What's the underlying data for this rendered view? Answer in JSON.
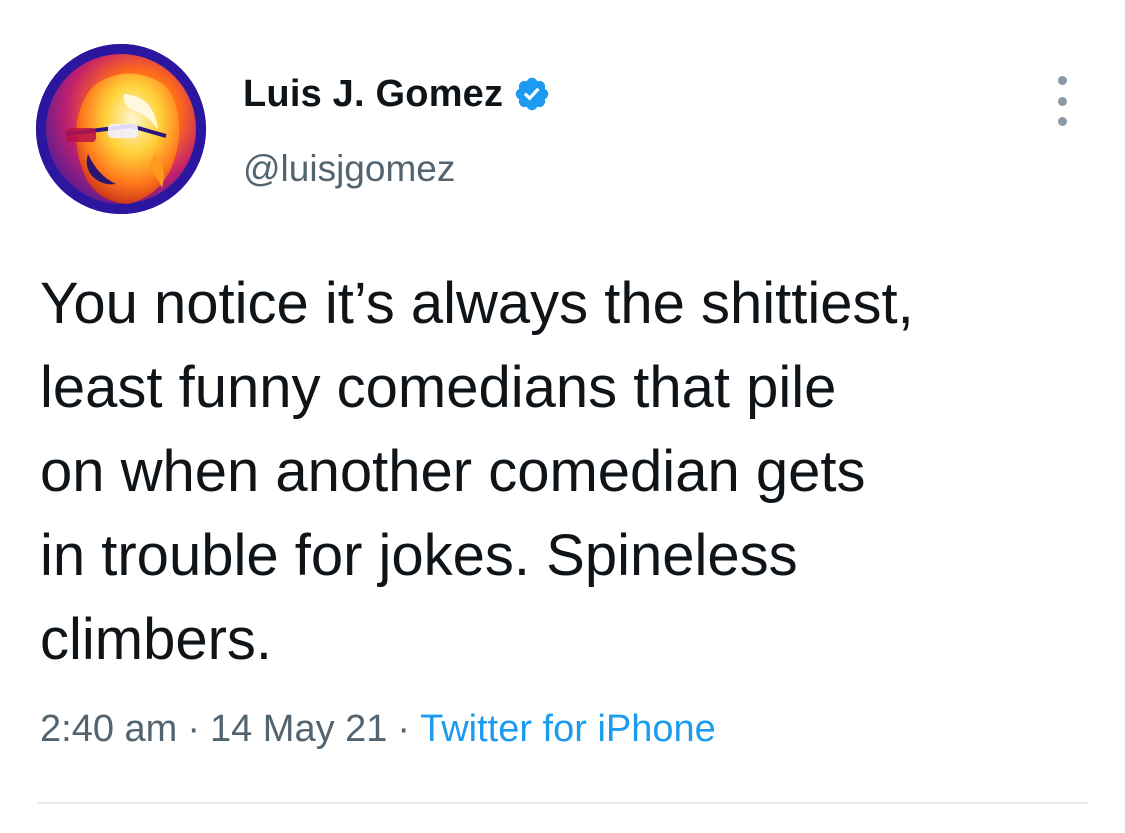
{
  "tweet": {
    "author": {
      "display_name": "Luis J. Gomez",
      "handle": "@luisjgomez",
      "verified": true,
      "avatar_icon": "stylized-portrait-avatar"
    },
    "text": "You notice it’s always the shittiest,\nleast funny comedians that pile\non when another comedian gets\nin trouble for jokes. Spineless\nclimbers.",
    "meta": {
      "time": "2:40 am",
      "separator": "·",
      "date": "14 May 21",
      "source": "Twitter for iPhone"
    },
    "more_icon": "more-vertical-icon",
    "colors": {
      "text": "#0f1419",
      "secondary": "#536471",
      "link": "#1d9bf0",
      "verified": "#1d9bf0"
    }
  }
}
